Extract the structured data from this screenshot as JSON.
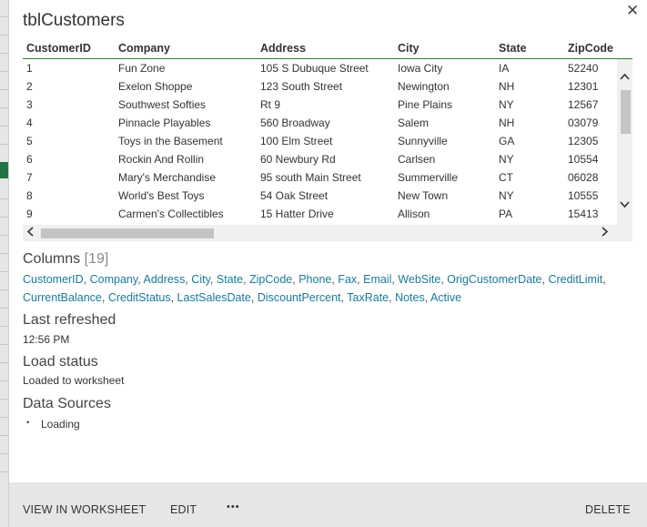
{
  "window": {
    "title": "tblCustomers",
    "close_glyph": "✕"
  },
  "table": {
    "headers": [
      "CustomerID",
      "Company",
      "Address",
      "City",
      "State",
      "ZipCode"
    ],
    "rows": [
      [
        "1",
        "Fun Zone",
        "105 S Dubuque Street",
        "Iowa City",
        "IA",
        "52240"
      ],
      [
        "2",
        "Exelon Shoppe",
        "123 South Street",
        "Newington",
        "NH",
        "12301"
      ],
      [
        "3",
        "Southwest Softies",
        "Rt 9",
        "Pine Plains",
        "NY",
        "12567"
      ],
      [
        "4",
        "Pinnacle Playables",
        "560 Broadway",
        "Salem",
        "NH",
        "03079"
      ],
      [
        "5",
        "Toys in the Basement",
        "100 Elm Street",
        "Sunnyville",
        "GA",
        "12305"
      ],
      [
        "6",
        "Rockin And Rollin",
        "60 Newbury Rd",
        "Carlsen",
        "NY",
        "10554"
      ],
      [
        "7",
        "Mary's Merchandise",
        "95 south Main Street",
        "Summerville",
        "CT",
        "06028"
      ],
      [
        "8",
        "World's Best Toys",
        "54 Oak Street",
        "New Town",
        "NY",
        "10555"
      ],
      [
        "9",
        "Carmen's Collectibles",
        "15 Hatter Drive",
        "Allison",
        "PA",
        "15413"
      ]
    ]
  },
  "columns": {
    "label": "Columns",
    "count": "[19]",
    "items": [
      "CustomerID",
      "Company",
      "Address",
      "City",
      "State",
      "ZipCode",
      "Phone",
      "Fax",
      "Email",
      "WebSite",
      "OrigCustomerDate",
      "CreditLimit",
      "CurrentBalance",
      "CreditStatus",
      "LastSalesDate",
      "DiscountPercent",
      "TaxRate",
      "Notes",
      "Active"
    ]
  },
  "last_refreshed": {
    "label": "Last refreshed",
    "value": "12:56 PM"
  },
  "load_status": {
    "label": "Load status",
    "value": "Loaded to worksheet"
  },
  "data_sources": {
    "label": "Data Sources",
    "bullet": "•",
    "items": [
      "Loading"
    ]
  },
  "footer": {
    "view_label": "VIEW IN WORKSHEET",
    "edit_label": "EDIT",
    "more_label": "•••",
    "delete_label": "DELETE"
  },
  "colors": {
    "link": "#1a7a9a",
    "header_rule": "#3a7a3a",
    "footer_bg": "#e6e6e6"
  }
}
